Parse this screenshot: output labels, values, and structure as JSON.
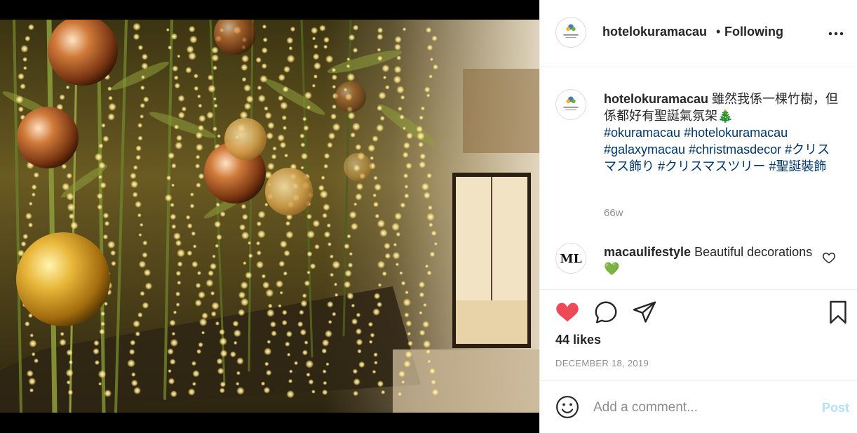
{
  "post": {
    "image_alt": "Christmas ornaments and fairy lights on bamboo",
    "header": {
      "username": "hotelokuramacau",
      "separator": "•",
      "follow_status": "Following",
      "avatar_icon": "hotel-okura-logo"
    },
    "caption": {
      "username": "hotelokuramacau",
      "text": "雖然我係一棵竹樹，但係都好有聖誕氣氛架🎄",
      "hashtags": [
        "#okuramacau",
        "#hotelokuramacau",
        "#galaxymacau",
        "#christmasdecor",
        "#クリスマス飾り",
        "#クリスマスツリー",
        "#聖誕裝飾"
      ],
      "time": "66w"
    },
    "comment": {
      "username": "macaulifestyle",
      "text": "Beautiful decorations 💚",
      "avatar_text": "ML"
    },
    "actions": {
      "liked": true,
      "like_color": "#ed4956",
      "icons": [
        "heart-icon",
        "comment-icon",
        "share-icon",
        "bookmark-icon"
      ]
    },
    "likes": "44 likes",
    "date": "DECEMBER 18, 2019",
    "add_comment": {
      "placeholder": "Add a comment...",
      "post_label": "Post",
      "post_color": "#b2dffc"
    }
  }
}
